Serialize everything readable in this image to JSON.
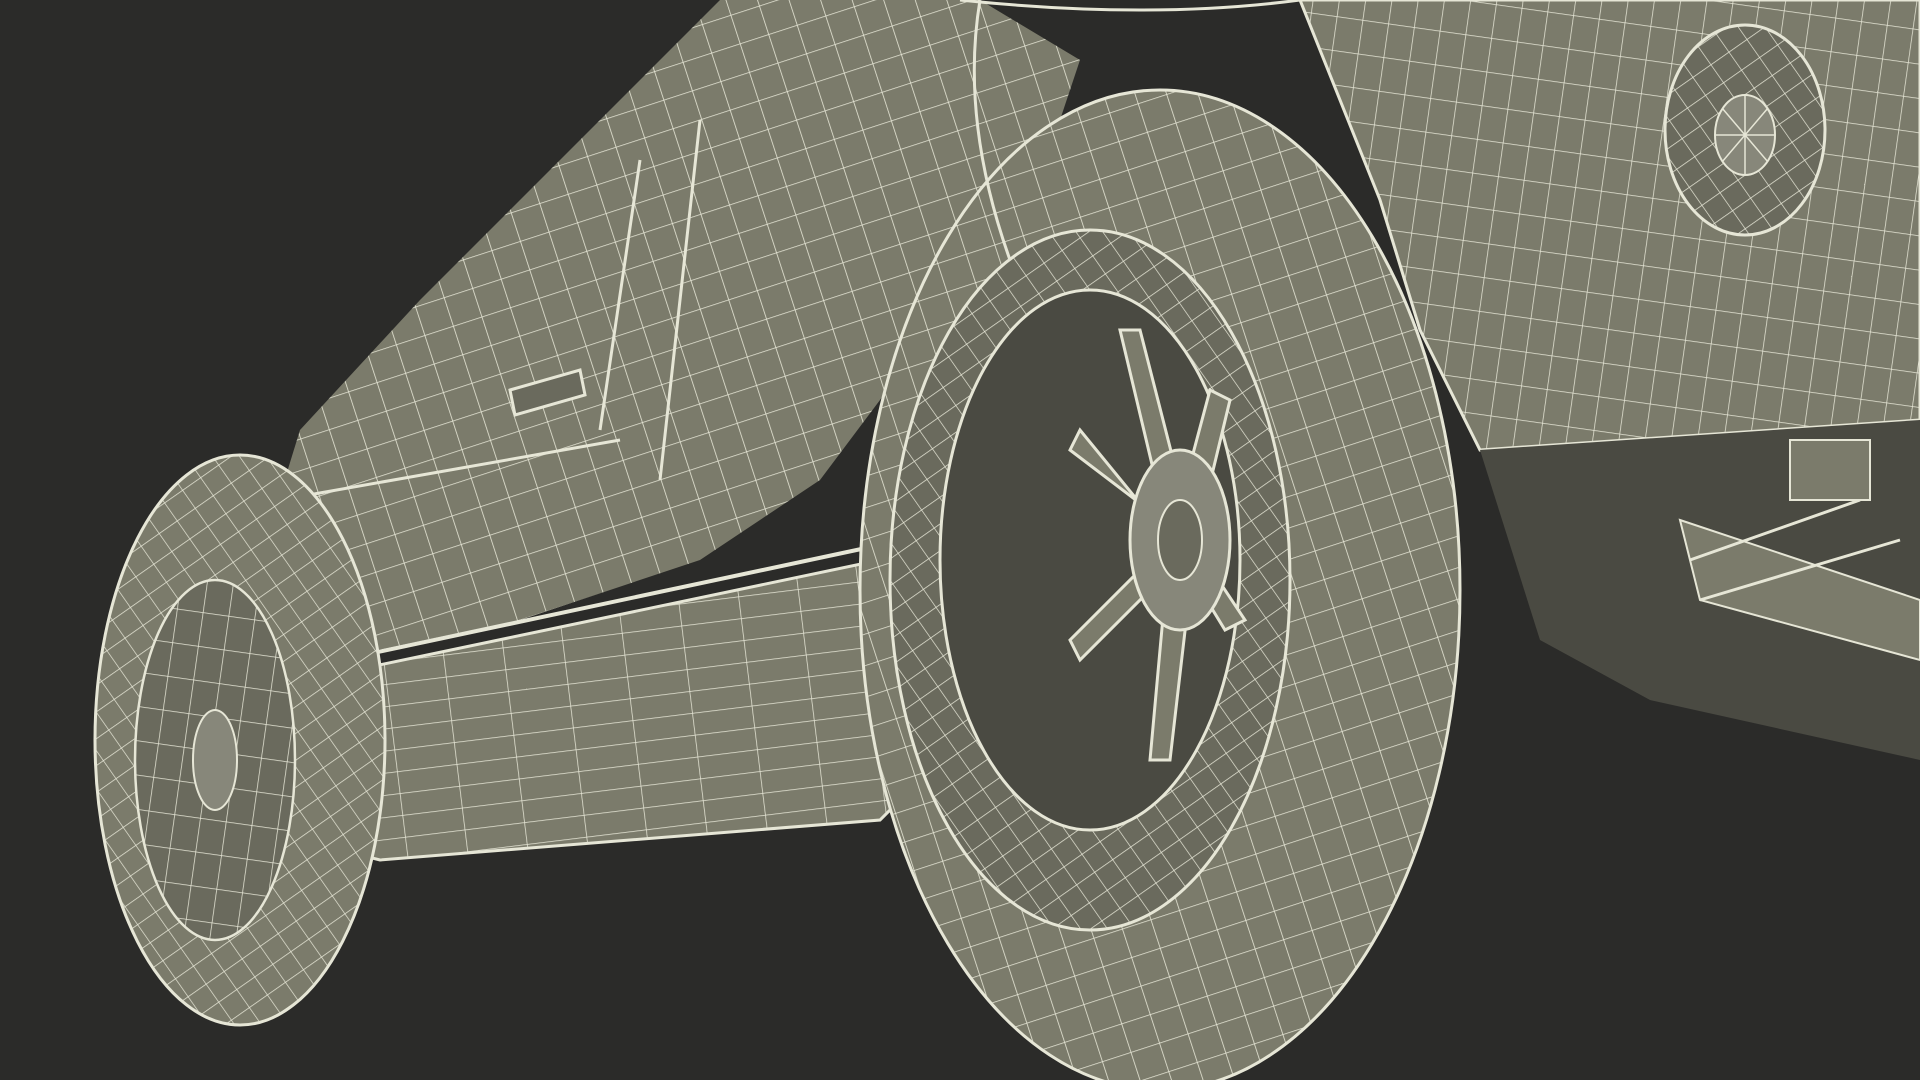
{
  "scene": {
    "subject": "car-wireframe-render",
    "colors": {
      "background": "#2b2b29",
      "surface": "#7b7b6b",
      "surface_dark": "#6a6a5d",
      "surface_light": "#87877a",
      "shadow": "#4a4a42",
      "wire": "#e6e6d6"
    }
  }
}
